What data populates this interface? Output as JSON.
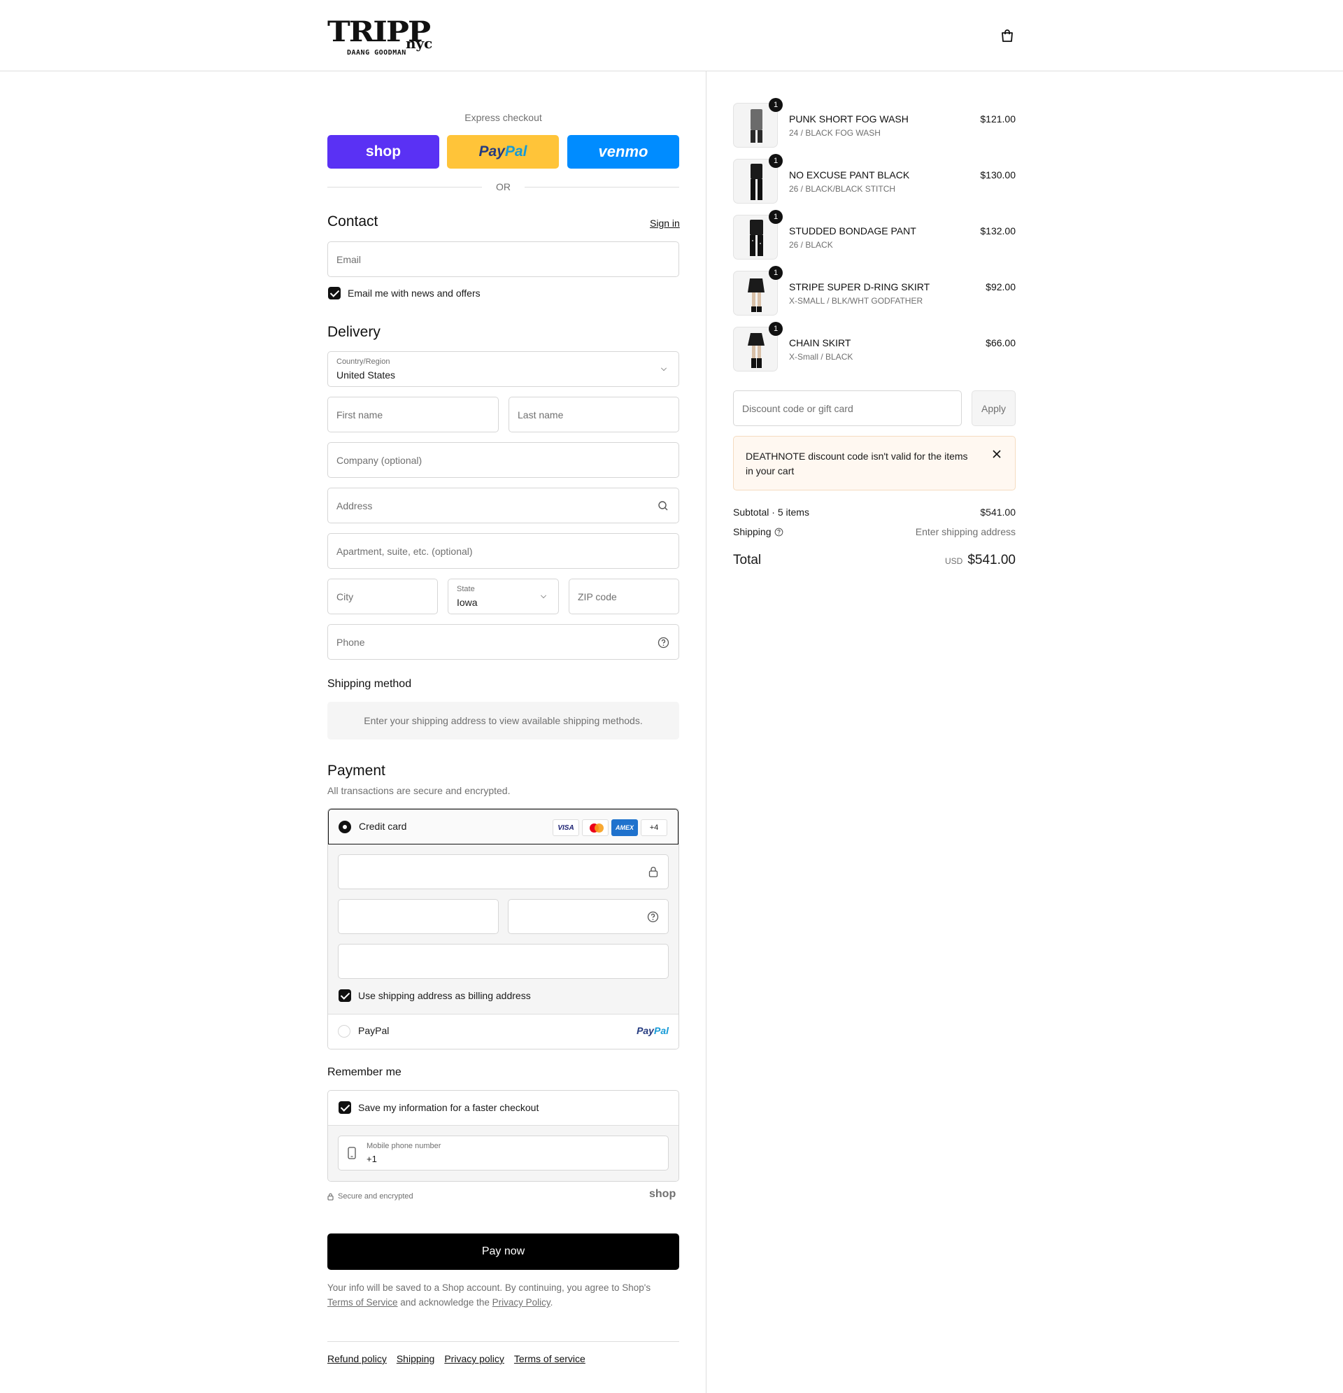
{
  "brand": {
    "logo_main": "TRIPP",
    "logo_nyc": "nyc",
    "logo_sub": "DAANG GOODMAN"
  },
  "express": {
    "title": "Express checkout",
    "shop": "shop",
    "paypal_a": "Pay",
    "paypal_b": "Pal",
    "venmo": "venmo",
    "or": "OR"
  },
  "contact": {
    "title": "Contact",
    "sign_in": "Sign in",
    "email_placeholder": "Email",
    "newsletter": "Email me with news and offers"
  },
  "delivery": {
    "title": "Delivery",
    "country_label": "Country/Region",
    "country_value": "United States",
    "first_name": "First name",
    "last_name": "Last name",
    "company": "Company (optional)",
    "address": "Address",
    "apartment": "Apartment, suite, etc. (optional)",
    "city": "City",
    "state_label": "State",
    "state_value": "Iowa",
    "zip": "ZIP code",
    "phone": "Phone"
  },
  "shipping_method": {
    "title": "Shipping method",
    "notice": "Enter your shipping address to view available shipping methods."
  },
  "payment": {
    "title": "Payment",
    "subtitle": "All transactions are secure and encrypted.",
    "credit_card": "Credit card",
    "visa": "VISA",
    "amex": "AMEX",
    "more_cards": "+4",
    "billing_same": "Use shipping address as billing address",
    "paypal": "PayPal",
    "paypal_logo_a": "Pay",
    "paypal_logo_b": "Pal"
  },
  "remember": {
    "title": "Remember me",
    "save_info": "Save my information for a faster checkout",
    "mobile_label": "Mobile phone number",
    "mobile_value": "+1",
    "secure": "Secure and encrypted",
    "shop": "shop"
  },
  "pay_now": "Pay now",
  "legal": {
    "line1": "Your info will be saved to a Shop account. By continuing, you agree to Shop's",
    "tos": "Terms of Service",
    "middle": " and acknowledge the ",
    "privacy": "Privacy Policy",
    "end": "."
  },
  "footer_links": [
    "Refund policy",
    "Shipping",
    "Privacy policy",
    "Terms of service"
  ],
  "cart": {
    "items": [
      {
        "name": "PUNK SHORT FOG WASH",
        "variant": "24 / BLACK FOG WASH",
        "price": "$121.00",
        "qty": "1"
      },
      {
        "name": "NO EXCUSE PANT BLACK",
        "variant": "26 / BLACK/BLACK STITCH",
        "price": "$130.00",
        "qty": "1"
      },
      {
        "name": "STUDDED BONDAGE PANT",
        "variant": "26 / BLACK",
        "price": "$132.00",
        "qty": "1"
      },
      {
        "name": "STRIPE SUPER D-RING SKIRT",
        "variant": "X-SMALL / BLK/WHT GODFATHER",
        "price": "$92.00",
        "qty": "1"
      },
      {
        "name": "CHAIN SKIRT",
        "variant": "X-Small / BLACK",
        "price": "$66.00",
        "qty": "1"
      }
    ],
    "discount_placeholder": "Discount code or gift card",
    "apply": "Apply",
    "error": "DEATHNOTE discount code isn't valid for the items in your cart",
    "subtotal_label": "Subtotal · 5 items",
    "subtotal": "$541.00",
    "shipping_label": "Shipping",
    "shipping_value": "Enter shipping address",
    "total_label": "Total",
    "currency": "USD",
    "total": "$541.00"
  },
  "colors": {
    "shop": "#5a31f4",
    "paypal": "#ffc439",
    "venmo": "#008cff",
    "error_bg": "#fff8f1",
    "error_border": "#f5dcc1"
  }
}
